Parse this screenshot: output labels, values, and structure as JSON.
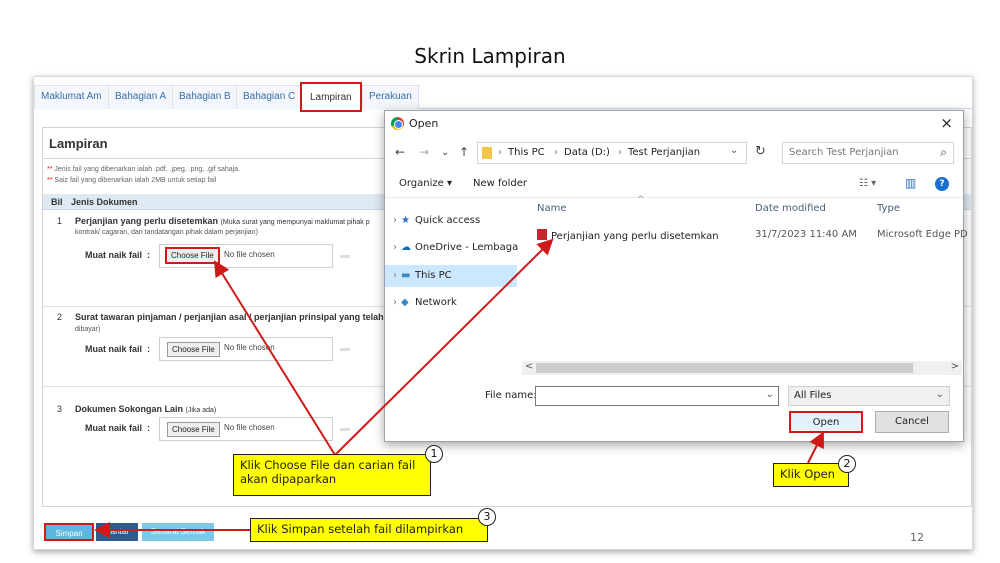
{
  "slide": {
    "title": "Skrin Lampiran",
    "page_number": "12"
  },
  "tabs": [
    {
      "label": "Maklumat Am",
      "active": false
    },
    {
      "label": "Bahagian A",
      "active": false
    },
    {
      "label": "Bahagian B",
      "active": false
    },
    {
      "label": "Bahagian C",
      "active": false
    },
    {
      "label": "Lampiran",
      "active": true
    },
    {
      "label": "Perakuan",
      "active": false
    }
  ],
  "panel": {
    "title": "Lampiran",
    "note_star": "**",
    "notes": [
      "Jenis fail yang dibenarkan ialah .pdf, .jpeg, .png, .gif sahaja.",
      "Saiz fail yang dibenarkan ialah 2MB untuk setiap fail"
    ],
    "col_bil": "Bil",
    "col_doc": "Jenis Dokumen",
    "upload_label": "Muat naik fail",
    "colon": ":",
    "choose_file": "Choose File",
    "no_file": "No file chosen",
    "rows": [
      {
        "num": "1",
        "title": "Perjanjian yang perlu disetemkan",
        "title_suffix": "(Muka surat yang mempunyai maklumat pihak p",
        "subtitle": "kontrak/ cagaran, dan tandatangan pihak dalam perjanjian)"
      },
      {
        "num": "2",
        "title": "Surat tawaran pinjaman / perjanjian asal / perjanjian prinsipal yang telah",
        "title_suffix": "",
        "subtitle": "dibayar)"
      },
      {
        "num": "3",
        "title": "Dokumen Sokongan Lain",
        "title_suffix": "(Jika ada)",
        "subtitle": ""
      }
    ],
    "buttons": {
      "save": "Simpan",
      "submit": "Hantar",
      "preview": "Senarai Semak"
    }
  },
  "dialog": {
    "title": "Open",
    "close": "×",
    "nav": {
      "back": "←",
      "forward": "→",
      "dropdown": "⌄",
      "up": "↑",
      "refresh": "↻",
      "addr_dropdown": "⌄"
    },
    "breadcrumb": [
      "This PC",
      "Data (D:)",
      "Test Perjanjian"
    ],
    "breadcrumb_sep": "›",
    "search_placeholder": "Search Test Perjanjian",
    "search_icon": "⌕",
    "organize": "Organize ▾",
    "new_folder": "New folder",
    "view_icon": "☷ ▾",
    "pane_icon": "▥",
    "help_icon": "?",
    "nav_items": [
      {
        "label": "Quick access",
        "icon": "★",
        "icon_color": "#2b6cc4",
        "selected": false
      },
      {
        "label": "OneDrive - Lembaga",
        "icon": "☁",
        "icon_color": "#0f6cbd",
        "selected": false
      },
      {
        "label": "This PC",
        "icon": "▬",
        "icon_color": "#3a86c8",
        "selected": true
      },
      {
        "label": "Network",
        "icon": "◆",
        "icon_color": "#3a86c8",
        "selected": false
      }
    ],
    "expand_glyph": "›",
    "columns": {
      "name": "Name",
      "date": "Date modified",
      "type": "Type"
    },
    "sort_glyph": "^",
    "file": {
      "name": "Perjanjian yang perlu disetemkan",
      "date": "31/7/2023 11:40 AM",
      "type": "Microsoft Edge PD"
    },
    "scroll_left": "<",
    "scroll_right": ">",
    "filename_label": "File name:",
    "filename_value": "",
    "filter": "All Files",
    "filter_arrow": "⌄",
    "open": "Open",
    "cancel": "Cancel"
  },
  "annotations": [
    {
      "num": "1",
      "text_line1": "Klik Choose File dan carian fail",
      "text_line2": "akan dipaparkan"
    },
    {
      "num": "2",
      "text_line1": "Klik Open",
      "text_line2": ""
    },
    {
      "num": "3",
      "text_line1": "Klik Simpan setelah fail dilampirkan",
      "text_line2": ""
    }
  ],
  "colors": {
    "highlight_red": "#d01a1a",
    "callout_yellow": "#ffff00",
    "tab_blue": "#3a6ea8",
    "button_blue": "#5bb6e0"
  }
}
